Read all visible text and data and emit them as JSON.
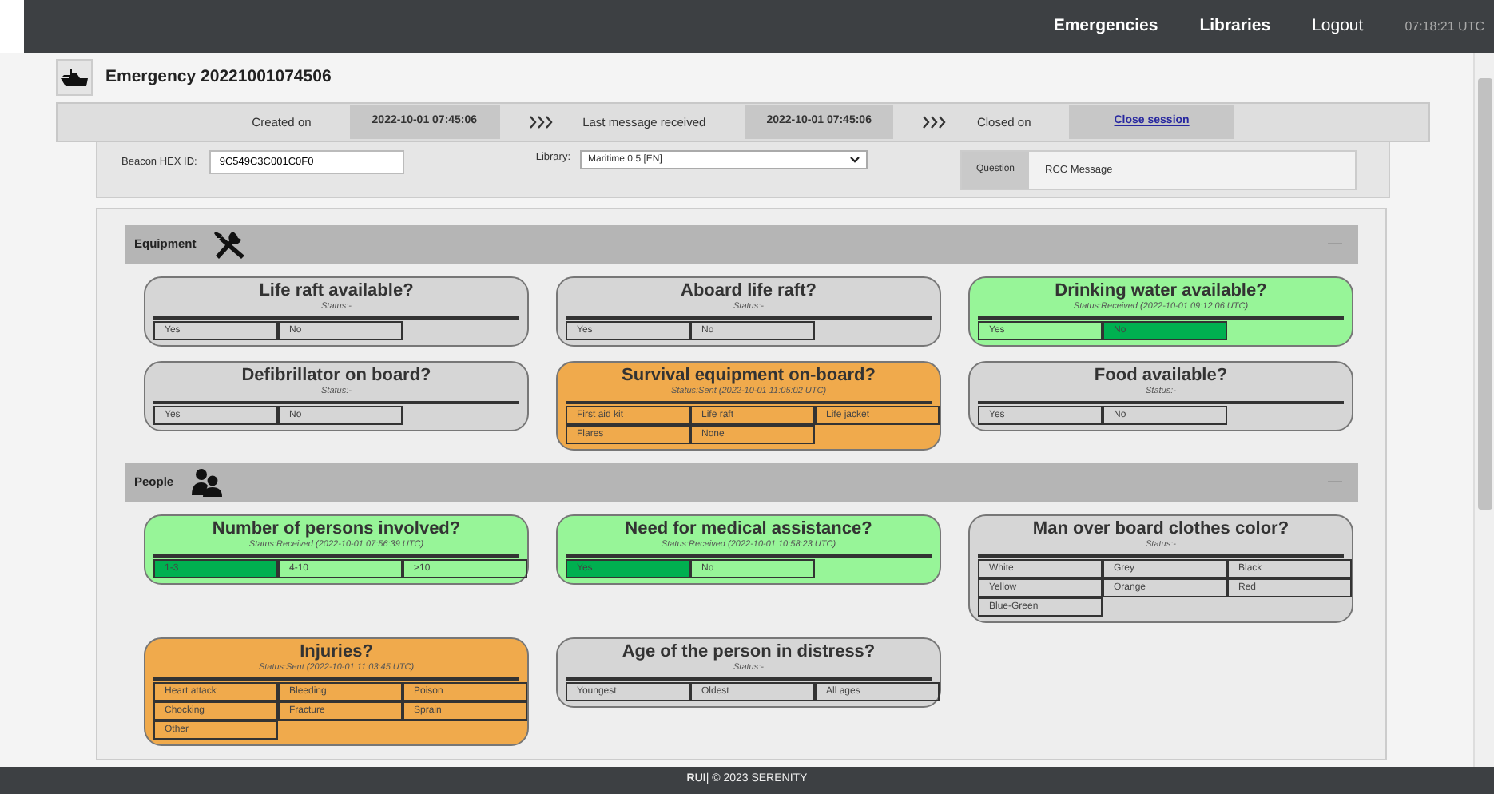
{
  "navbar": {
    "links": [
      {
        "label": "Emergencies",
        "bold": true
      },
      {
        "label": "Libraries",
        "bold": true
      },
      {
        "label": "Logout",
        "bold": false
      }
    ],
    "clock": "07:18:21 UTC"
  },
  "header": {
    "title": "Emergency 20221001074506"
  },
  "timeline": [
    {
      "label": "Created on",
      "value": "2022-10-01 07:45:06",
      "kind": "date"
    },
    {
      "label": "Last message received",
      "value": "2022-10-01 07:45:06",
      "kind": "date"
    },
    {
      "label": "Closed on",
      "value": "Close session",
      "kind": "link"
    }
  ],
  "details": {
    "beacon_label": "Beacon HEX ID:",
    "beacon_value": "9C549C3C001C0F0",
    "library_label": "Library:",
    "library_value": "Maritime 0.5 [EN]",
    "question_tab": "Question",
    "question_text": "RCC Message"
  },
  "sections": [
    {
      "title": "Equipment",
      "kind": "tools",
      "toggle": "—",
      "questions": [
        {
          "title": "Life raft available?",
          "status": "Status:-",
          "color": "#d6d6d6",
          "options": [
            {
              "label": "Yes",
              "selected": false
            },
            {
              "label": "No",
              "selected": false
            }
          ]
        },
        {
          "title": "Aboard life raft?",
          "status": "Status:-",
          "color": "#d6d6d6",
          "options": [
            {
              "label": "Yes",
              "selected": false
            },
            {
              "label": "No",
              "selected": false
            }
          ]
        },
        {
          "title": "Drinking water available?",
          "status": "Status:Received (2022-10-01 09:12:06 UTC)",
          "color": "#97f598",
          "options": [
            {
              "label": "Yes",
              "selected": false
            },
            {
              "label": "No",
              "selected": true
            }
          ]
        },
        {
          "title": "Defibrillator on board?",
          "status": "Status:-",
          "color": "#d6d6d6",
          "options": [
            {
              "label": "Yes",
              "selected": false
            },
            {
              "label": "No",
              "selected": false
            }
          ]
        },
        {
          "title": "Survival equipment on-board?",
          "status": "Status:Sent (2022-10-01 11:05:02 UTC)",
          "color": "#f0aa4c",
          "options": [
            {
              "label": "First aid kit",
              "selected": false
            },
            {
              "label": "Life raft",
              "selected": false
            },
            {
              "label": "Life jacket",
              "selected": false
            },
            {
              "label": "Flares",
              "selected": false
            },
            {
              "label": "None",
              "selected": false
            }
          ]
        },
        {
          "title": "Food available?",
          "status": "Status:-",
          "color": "#d6d6d6",
          "options": [
            {
              "label": "Yes",
              "selected": false
            },
            {
              "label": "No",
              "selected": false
            }
          ]
        }
      ]
    },
    {
      "title": "People",
      "kind": "people",
      "toggle": "—",
      "questions": [
        {
          "title": "Number of persons involved?",
          "status": "Status:Received (2022-10-01 07:56:39 UTC)",
          "color": "#97f598",
          "options": [
            {
              "label": "1-3",
              "selected": true
            },
            {
              "label": "4-10",
              "selected": false
            },
            {
              "label": ">10",
              "selected": false
            }
          ]
        },
        {
          "title": "Need for medical assistance?",
          "status": "Status:Received (2022-10-01 10:58:23 UTC)",
          "color": "#97f598",
          "options": [
            {
              "label": "Yes",
              "selected": true
            },
            {
              "label": "No",
              "selected": false
            }
          ]
        },
        {
          "title": "Man over board clothes color?",
          "status": "Status:-",
          "color": "#d6d6d6",
          "options": [
            {
              "label": "White",
              "selected": false
            },
            {
              "label": "Grey",
              "selected": false
            },
            {
              "label": "Black",
              "selected": false
            },
            {
              "label": "Yellow",
              "selected": false
            },
            {
              "label": "Orange",
              "selected": false
            },
            {
              "label": "Red",
              "selected": false
            },
            {
              "label": "Blue-Green",
              "selected": false
            }
          ]
        },
        {
          "title": "Injuries?",
          "status": "Status:Sent (2022-10-01 11:03:45 UTC)",
          "color": "#f0aa4c",
          "options": [
            {
              "label": "Heart attack",
              "selected": false
            },
            {
              "label": "Bleeding",
              "selected": false
            },
            {
              "label": "Poison",
              "selected": false
            },
            {
              "label": "Chocking",
              "selected": false
            },
            {
              "label": "Fracture",
              "selected": false
            },
            {
              "label": "Sprain",
              "selected": false
            },
            {
              "label": "Other",
              "selected": false
            }
          ]
        },
        {
          "title": "Age of the person in distress?",
          "status": "Status:-",
          "color": "#d6d6d6",
          "options": [
            {
              "label": "Youngest",
              "selected": false
            },
            {
              "label": "Oldest",
              "selected": false
            },
            {
              "label": "All ages",
              "selected": false
            }
          ]
        }
      ]
    }
  ],
  "footer": {
    "brand": "RUI",
    "text": "| © 2023 SERENITY"
  }
}
